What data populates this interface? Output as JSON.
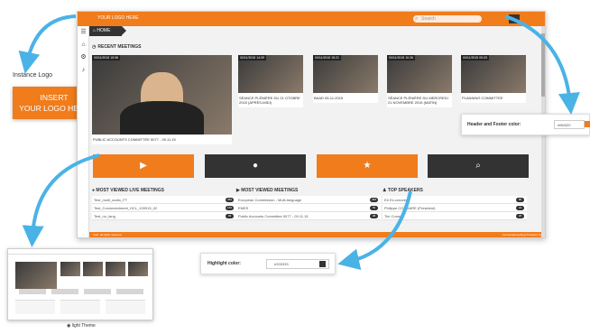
{
  "app": {
    "logo_text": "YOUR LOGO HERE",
    "search_placeholder": "Search",
    "breadcrumb": "HOME",
    "recent_title": "RECENT MEETINGS",
    "colors": {
      "header_footer": "#f07c1c",
      "highlight": "#333333"
    }
  },
  "meetings": [
    {
      "stamp": "00/11/2015 15:08",
      "caption": "PUBLIC ACCOUNTS COMMITTEE 5077 - 09.11.15"
    },
    {
      "stamp": "00/11/2015 14:09",
      "caption": "SÉANCE PLÉNIÈRE DU 21 OTOBRE 2015 (APRÈS-MIDI)"
    },
    {
      "stamp": "00/11/2015 15:21",
      "caption": "BAAD 05-11-2015"
    },
    {
      "stamp": "00/11/2015 10:26",
      "caption": "SÉANCE PLÉNIÈRE DU MERCREDI 21 NOVEMBRE 2015 (MATIN)"
    },
    {
      "stamp": "00/11/2015 09:03",
      "caption": "PLANNING COMMITTEE"
    }
  ],
  "big_buttons": [
    {
      "icon": "play-icon",
      "glyph": "▶"
    },
    {
      "icon": "microphone-icon",
      "glyph": "🎤"
    },
    {
      "icon": "star-icon",
      "glyph": "★"
    },
    {
      "icon": "search-icon",
      "glyph": "🔍"
    }
  ],
  "lists": [
    {
      "title": "MOST VIEWED LIVE MEETINGS",
      "rows": [
        {
          "label": "Test_multi_audio_FT",
          "count": "450"
        },
        {
          "label": "Test_Connectedmeet_HCL_100915_02",
          "count": "156"
        },
        {
          "label": "Test_no_lang",
          "count": "39"
        }
      ]
    },
    {
      "title": "MOST VIEWED MEETINGS",
      "rows": [
        {
          "label": "European Commission - Multi-language",
          "count": "458"
        },
        {
          "label": "EMES",
          "count": "59"
        },
        {
          "label": "Public Accounts Committee 5077 - 09.11.15",
          "count": "38"
        }
      ]
    },
    {
      "title": "TOP SPEAKERS",
      "rows": [
        {
          "label": "Eb Ex-ccnoreg",
          "count": "86"
        },
        {
          "label": "Philippe COUMARE (President)",
          "count": "34"
        },
        {
          "label": "Tim Conway",
          "count": "26"
        }
      ]
    }
  ],
  "footer": {
    "left": "Auto, all rights reserved",
    "right": "Connectedmeetings Powered by"
  },
  "instance_logo": {
    "label": "Instance Logo",
    "line1": "INSERT",
    "line2": "YOUR LOGO HERE"
  },
  "header_footer_panel": {
    "label": "Header and Footer color:",
    "value": "ef8d320"
  },
  "highlight_panel": {
    "label": "Highlight color:",
    "value": "#333333"
  },
  "theme_caption": "light Theme"
}
